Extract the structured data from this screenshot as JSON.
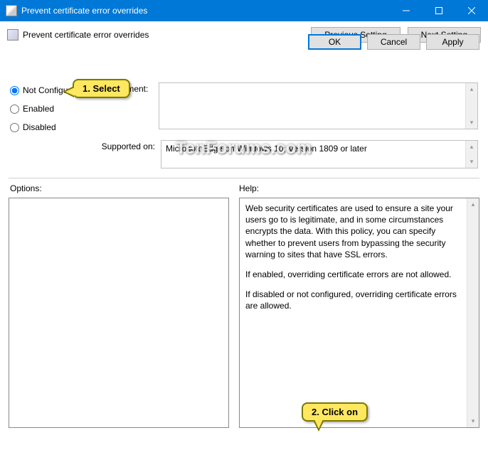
{
  "window": {
    "title": "Prevent certificate error overrides"
  },
  "header": {
    "title": "Prevent certificate error overrides",
    "prev_btn": "Previous Setting",
    "next_btn": "Next Setting"
  },
  "radios": {
    "not_configured": "Not Configured",
    "enabled": "Enabled",
    "disabled": "Disabled",
    "selected": "not_configured"
  },
  "labels": {
    "comment": "Comment:",
    "supported": "Supported on:",
    "options": "Options:",
    "help": "Help:"
  },
  "supported_text": "Microsoft Edge on Windows 10, Version 1809 or later",
  "comment_text": "",
  "options_text": "",
  "help_text": {
    "p1": "Web security certificates are used to ensure a site your users go to is legitimate, and in some circumstances encrypts the data. With this policy, you can specify whether to prevent users from bypassing the security warning to sites that have SSL errors.",
    "p2": "If enabled, overriding certificate errors are not allowed.",
    "p3": "If disabled or not configured, overriding certificate errors are allowed."
  },
  "buttons": {
    "ok": "OK",
    "cancel": "Cancel",
    "apply": "Apply"
  },
  "callouts": {
    "c1": "1. Select",
    "c2": "2. Click on"
  },
  "watermark": "TenForums.com"
}
